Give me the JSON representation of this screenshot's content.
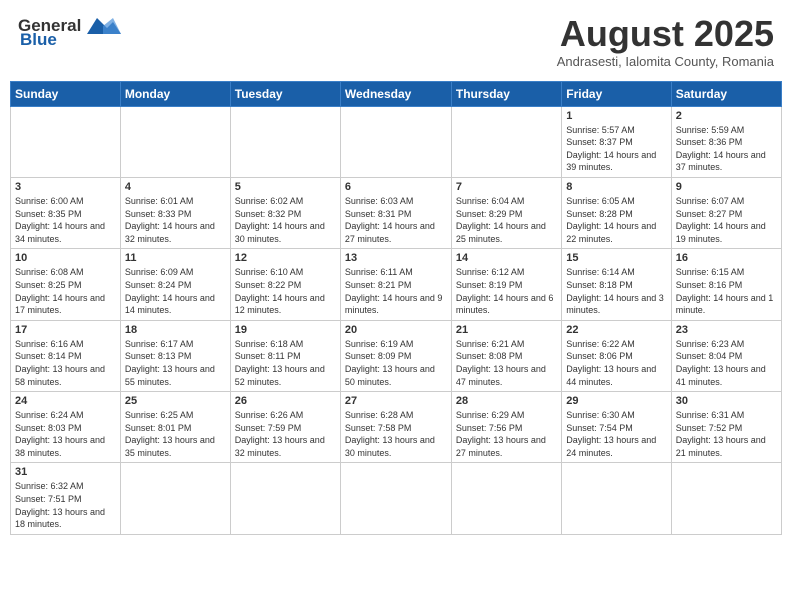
{
  "header": {
    "logo_general": "General",
    "logo_blue": "Blue",
    "title": "August 2025",
    "subtitle": "Andrasesti, Ialomita County, Romania"
  },
  "days_of_week": [
    "Sunday",
    "Monday",
    "Tuesday",
    "Wednesday",
    "Thursday",
    "Friday",
    "Saturday"
  ],
  "weeks": [
    [
      {
        "day": "",
        "info": ""
      },
      {
        "day": "",
        "info": ""
      },
      {
        "day": "",
        "info": ""
      },
      {
        "day": "",
        "info": ""
      },
      {
        "day": "",
        "info": ""
      },
      {
        "day": "1",
        "info": "Sunrise: 5:57 AM\nSunset: 8:37 PM\nDaylight: 14 hours and 39 minutes."
      },
      {
        "day": "2",
        "info": "Sunrise: 5:59 AM\nSunset: 8:36 PM\nDaylight: 14 hours and 37 minutes."
      }
    ],
    [
      {
        "day": "3",
        "info": "Sunrise: 6:00 AM\nSunset: 8:35 PM\nDaylight: 14 hours and 34 minutes."
      },
      {
        "day": "4",
        "info": "Sunrise: 6:01 AM\nSunset: 8:33 PM\nDaylight: 14 hours and 32 minutes."
      },
      {
        "day": "5",
        "info": "Sunrise: 6:02 AM\nSunset: 8:32 PM\nDaylight: 14 hours and 30 minutes."
      },
      {
        "day": "6",
        "info": "Sunrise: 6:03 AM\nSunset: 8:31 PM\nDaylight: 14 hours and 27 minutes."
      },
      {
        "day": "7",
        "info": "Sunrise: 6:04 AM\nSunset: 8:29 PM\nDaylight: 14 hours and 25 minutes."
      },
      {
        "day": "8",
        "info": "Sunrise: 6:05 AM\nSunset: 8:28 PM\nDaylight: 14 hours and 22 minutes."
      },
      {
        "day": "9",
        "info": "Sunrise: 6:07 AM\nSunset: 8:27 PM\nDaylight: 14 hours and 19 minutes."
      }
    ],
    [
      {
        "day": "10",
        "info": "Sunrise: 6:08 AM\nSunset: 8:25 PM\nDaylight: 14 hours and 17 minutes."
      },
      {
        "day": "11",
        "info": "Sunrise: 6:09 AM\nSunset: 8:24 PM\nDaylight: 14 hours and 14 minutes."
      },
      {
        "day": "12",
        "info": "Sunrise: 6:10 AM\nSunset: 8:22 PM\nDaylight: 14 hours and 12 minutes."
      },
      {
        "day": "13",
        "info": "Sunrise: 6:11 AM\nSunset: 8:21 PM\nDaylight: 14 hours and 9 minutes."
      },
      {
        "day": "14",
        "info": "Sunrise: 6:12 AM\nSunset: 8:19 PM\nDaylight: 14 hours and 6 minutes."
      },
      {
        "day": "15",
        "info": "Sunrise: 6:14 AM\nSunset: 8:18 PM\nDaylight: 14 hours and 3 minutes."
      },
      {
        "day": "16",
        "info": "Sunrise: 6:15 AM\nSunset: 8:16 PM\nDaylight: 14 hours and 1 minute."
      }
    ],
    [
      {
        "day": "17",
        "info": "Sunrise: 6:16 AM\nSunset: 8:14 PM\nDaylight: 13 hours and 58 minutes."
      },
      {
        "day": "18",
        "info": "Sunrise: 6:17 AM\nSunset: 8:13 PM\nDaylight: 13 hours and 55 minutes."
      },
      {
        "day": "19",
        "info": "Sunrise: 6:18 AM\nSunset: 8:11 PM\nDaylight: 13 hours and 52 minutes."
      },
      {
        "day": "20",
        "info": "Sunrise: 6:19 AM\nSunset: 8:09 PM\nDaylight: 13 hours and 50 minutes."
      },
      {
        "day": "21",
        "info": "Sunrise: 6:21 AM\nSunset: 8:08 PM\nDaylight: 13 hours and 47 minutes."
      },
      {
        "day": "22",
        "info": "Sunrise: 6:22 AM\nSunset: 8:06 PM\nDaylight: 13 hours and 44 minutes."
      },
      {
        "day": "23",
        "info": "Sunrise: 6:23 AM\nSunset: 8:04 PM\nDaylight: 13 hours and 41 minutes."
      }
    ],
    [
      {
        "day": "24",
        "info": "Sunrise: 6:24 AM\nSunset: 8:03 PM\nDaylight: 13 hours and 38 minutes."
      },
      {
        "day": "25",
        "info": "Sunrise: 6:25 AM\nSunset: 8:01 PM\nDaylight: 13 hours and 35 minutes."
      },
      {
        "day": "26",
        "info": "Sunrise: 6:26 AM\nSunset: 7:59 PM\nDaylight: 13 hours and 32 minutes."
      },
      {
        "day": "27",
        "info": "Sunrise: 6:28 AM\nSunset: 7:58 PM\nDaylight: 13 hours and 30 minutes."
      },
      {
        "day": "28",
        "info": "Sunrise: 6:29 AM\nSunset: 7:56 PM\nDaylight: 13 hours and 27 minutes."
      },
      {
        "day": "29",
        "info": "Sunrise: 6:30 AM\nSunset: 7:54 PM\nDaylight: 13 hours and 24 minutes."
      },
      {
        "day": "30",
        "info": "Sunrise: 6:31 AM\nSunset: 7:52 PM\nDaylight: 13 hours and 21 minutes."
      }
    ],
    [
      {
        "day": "31",
        "info": "Sunrise: 6:32 AM\nSunset: 7:51 PM\nDaylight: 13 hours and 18 minutes."
      },
      {
        "day": "",
        "info": ""
      },
      {
        "day": "",
        "info": ""
      },
      {
        "day": "",
        "info": ""
      },
      {
        "day": "",
        "info": ""
      },
      {
        "day": "",
        "info": ""
      },
      {
        "day": "",
        "info": ""
      }
    ]
  ]
}
